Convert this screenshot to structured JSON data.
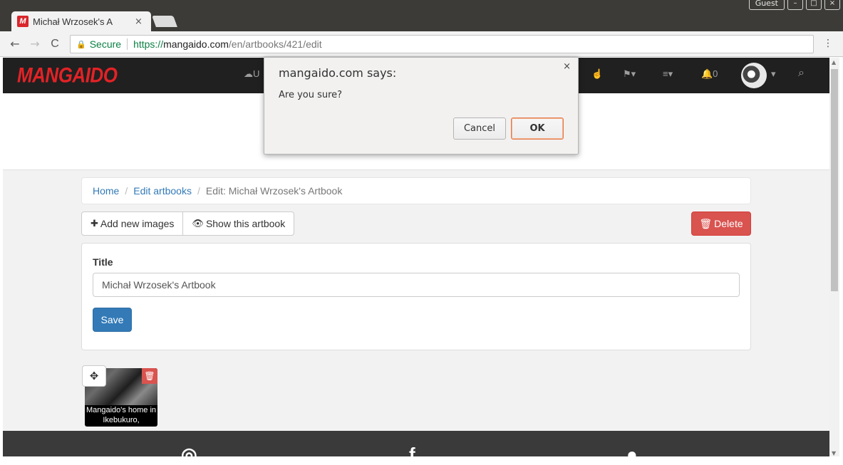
{
  "browser": {
    "tab_title": "Michał Wrzosek's A",
    "tab_close": "×",
    "favicon_letter": "M",
    "guest_label": "Guest",
    "window_controls": [
      "–",
      "□",
      "×"
    ],
    "nav": {
      "back": "←",
      "forward": "→",
      "reload": "C"
    },
    "omnibox": {
      "secure_label": "Secure",
      "url_scheme": "https://",
      "url_host": "mangaido.com",
      "url_path": "/en/artbooks/421/edit"
    },
    "menu_icon": "⋮"
  },
  "site": {
    "logo": "MANGAIDO",
    "nav_icons": [
      {
        "name": "upload-icon",
        "glyph": "☁U"
      },
      {
        "name": "hand-icon",
        "glyph": "☝"
      },
      {
        "name": "flag-icon",
        "glyph": "⚑▾"
      },
      {
        "name": "menu-icon",
        "glyph": "≡▾"
      },
      {
        "name": "bell-icon",
        "glyph": "🔔0"
      },
      {
        "name": "avatar-caret",
        "glyph": "▾"
      },
      {
        "name": "search-icon",
        "glyph": "⌕"
      }
    ],
    "notification_count": "0"
  },
  "breadcrumb": {
    "home": "Home",
    "edit_artbooks": "Edit artbooks",
    "separator": "/",
    "current": "Edit: Michał Wrzosek's Artbook"
  },
  "actions": {
    "add_images": "Add new images",
    "show_artbook": "Show this artbook",
    "delete": "Delete"
  },
  "form": {
    "title_label": "Title",
    "title_value": "Michał Wrzosek's Artbook",
    "save": "Save"
  },
  "images": [
    {
      "caption": "Mangaido's home in Ikebukuro,"
    }
  ],
  "dialog": {
    "title": "mangaido.com says:",
    "message": "Are you sure?",
    "cancel": "Cancel",
    "ok": "OK",
    "close": "×"
  }
}
